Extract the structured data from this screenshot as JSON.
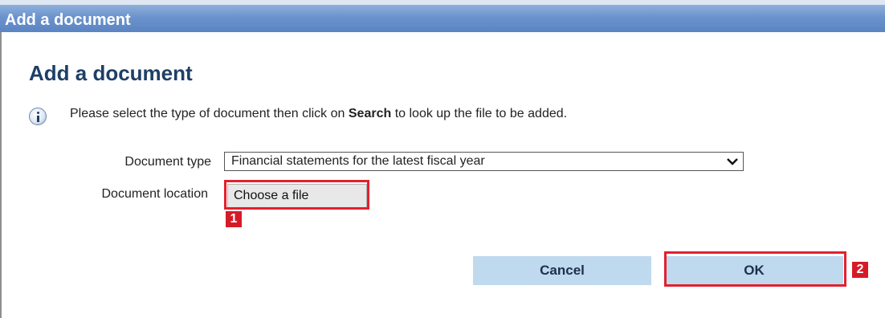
{
  "window": {
    "title": "Add a document"
  },
  "dialog": {
    "heading": "Add a document",
    "info": {
      "icon": "info-icon",
      "text_before": "Please select the type of document then click on ",
      "text_bold": "Search",
      "text_after": " to look up the file to be added."
    },
    "document_type": {
      "label": "Document type",
      "selected": "Financial statements for the latest fiscal year"
    },
    "document_location": {
      "label": "Document location",
      "button": "Choose a file"
    },
    "buttons": {
      "cancel": "Cancel",
      "ok": "OK"
    }
  },
  "annotations": {
    "badge_1": "1",
    "badge_2": "2",
    "highlight_color": "#e3202d"
  }
}
